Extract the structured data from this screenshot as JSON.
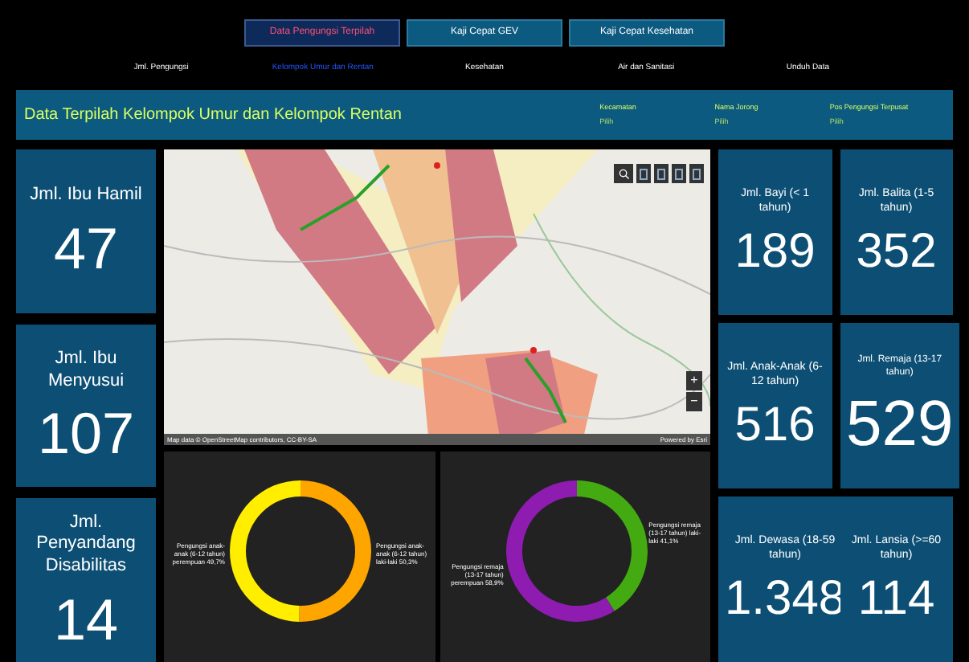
{
  "top_buttons": [
    {
      "label": "Data Pengungsi Terpilah",
      "selected": true
    },
    {
      "label": "Kaji Cepat GEV",
      "selected": false
    },
    {
      "label": "Kaji Cepat Kesehatan",
      "selected": false
    }
  ],
  "nav_tabs": [
    {
      "label": "Jml. Pengungsi",
      "selected": false
    },
    {
      "label": "Kelompok Umur dan Rentan",
      "selected": true
    },
    {
      "label": "Kesehatan",
      "selected": false
    },
    {
      "label": "Air dan Sanitasi",
      "selected": false
    },
    {
      "label": "Unduh Data",
      "selected": false
    }
  ],
  "banner": {
    "title": "Data Terpilah Kelompok Umur dan Kelompok Rentan",
    "filters": [
      {
        "label": "Kecamatan",
        "value": "Pilih"
      },
      {
        "label": "Nama Jorong",
        "value": "Pilih"
      },
      {
        "label": "Pos Pengungsi Terpusat",
        "value": "Pilih"
      }
    ]
  },
  "left_cards": [
    {
      "label": "Jml. Ibu Hamil",
      "value": "47"
    },
    {
      "label": "Jml. Ibu Menyusui",
      "value": "107"
    },
    {
      "label": "Jml. Penyandang Disabilitas",
      "value": "14"
    }
  ],
  "map": {
    "attribution": "Map data © OpenStreetMap contributors, CC-BY-SA",
    "powered_by": "Powered by Esri",
    "zoom_in": "+",
    "zoom_out": "−"
  },
  "donuts": [
    {
      "chart_data": {
        "type": "donut",
        "categories": [
          "Pengungsi anak-anak (6-12 tahun) laki-laki",
          "Pengungsi anak-anak (6-12 tahun) perempuan"
        ],
        "values": [
          50.3,
          49.7
        ],
        "colors": [
          "#ffa500",
          "#ffee00"
        ],
        "value_labels": [
          "50,3%",
          "49,7%"
        ]
      }
    },
    {
      "chart_data": {
        "type": "donut",
        "categories": [
          "Pengungsi remaja (13-17 tahun) laki-laki",
          "Pengungsi remaja (13-17 tahun) perempuan"
        ],
        "values": [
          41.1,
          58.9
        ],
        "colors": [
          "#44aa11",
          "#8e1cb0"
        ],
        "value_labels": [
          "41,1%",
          "58,9%"
        ]
      }
    }
  ],
  "right_cards": [
    {
      "label": "Jml. Bayi (< 1 tahun)",
      "value": "189"
    },
    {
      "label": "Jml. Balita (1-5 tahun)",
      "value": "352"
    },
    {
      "label": "Jml. Anak-Anak (6-12 tahun)",
      "value": "516"
    },
    {
      "label": "Jml. Remaja (13-17 tahun)",
      "value": "529"
    },
    {
      "label": "Jml. Dewasa (18-59 tahun)",
      "value": "1.348"
    },
    {
      "label": "Jml. Lansia (>=60 tahun)",
      "value": "114"
    }
  ]
}
